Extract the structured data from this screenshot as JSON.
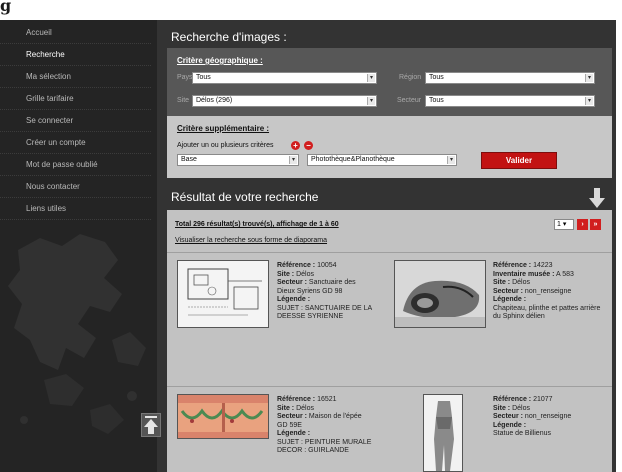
{
  "header": {
    "logo_text": "g"
  },
  "sidebar": {
    "items": [
      {
        "label": "Accueil",
        "active": false
      },
      {
        "label": "Recherche",
        "active": true
      },
      {
        "label": "Ma sélection",
        "active": false
      },
      {
        "label": "Grille tarifaire",
        "active": false
      },
      {
        "label": "Se connecter",
        "active": false
      },
      {
        "label": "Créer un compte",
        "active": false
      },
      {
        "label": "Mot de passe oublié",
        "active": false
      },
      {
        "label": "Nous contacter",
        "active": false
      },
      {
        "label": "Liens utiles",
        "active": false
      }
    ]
  },
  "search": {
    "title": "Recherche d'images :",
    "geo": {
      "heading": "Critère géographique :",
      "pays_label": "Pays",
      "pays_value": "Tous",
      "region_label": "Région",
      "region_value": "Tous",
      "site_label": "Site",
      "site_value": "Délos (296)",
      "secteur_label": "Secteur",
      "secteur_value": "Tous"
    },
    "sup": {
      "heading": "Critère supplémentaire :",
      "add_text": "Ajouter un ou plusieurs critères",
      "base_value": "Base",
      "photo_value": "Photothèque&Planothèque",
      "validate_label": "Valider"
    }
  },
  "results": {
    "title": "Résultat de votre recherche",
    "total_text": "Total 296 résultat(s) trouvé(s), affichage de 1 à 60",
    "slideshow_link": "Visualiser la recherche sous forme de diaporama",
    "page_value": "1",
    "items": [
      {
        "ref_label": "Référence :",
        "ref": "10054",
        "l2_label": "Site :",
        "l2": "Délos",
        "l3_label": "Secteur :",
        "l3": "Sanctuaire des Dieux Syriens GD 98",
        "leg_label": "Légende :",
        "leg": "SUJET : SANCTUAIRE DE LA DEESSE SYRIENNE"
      },
      {
        "ref_label": "Référence :",
        "ref": "14223",
        "l2_label": "Inventaire musée :",
        "l2": "A 583",
        "l3_label": "Site :",
        "l3": "Délos",
        "l4_label": "Secteur :",
        "l4": "non_renseigne",
        "leg_label": "Légende :",
        "leg": "Chapiteau, plinthe et pattes arrière du Sphinx délien"
      },
      {
        "ref_label": "Référence :",
        "ref": "16521",
        "l2_label": "Site :",
        "l2": "Délos",
        "l3_label": "Secteur :",
        "l3": "Maison de l'épée GD 59E",
        "leg_label": "Légende :",
        "leg": "SUJET : PEINTURE MURALE DECOR : GUIRLANDE"
      },
      {
        "ref_label": "Référence :",
        "ref": "21077",
        "l2_label": "Site :",
        "l2": "Délos",
        "l3_label": "Secteur :",
        "l3": "non_renseigne",
        "leg_label": "Légende :",
        "leg": "Statue de Billienus"
      }
    ]
  },
  "colors": {
    "accent": "#c21212",
    "sidebar_bg": "#242424",
    "main_bg": "#333333"
  },
  "icons": {
    "add": "plus-circle-icon",
    "remove": "minus-circle-icon",
    "scroll_down": "arrow-down-icon",
    "back_to_top": "arrow-up-icon",
    "next": "chevron-right-icon",
    "last": "double-chevron-right-icon"
  }
}
